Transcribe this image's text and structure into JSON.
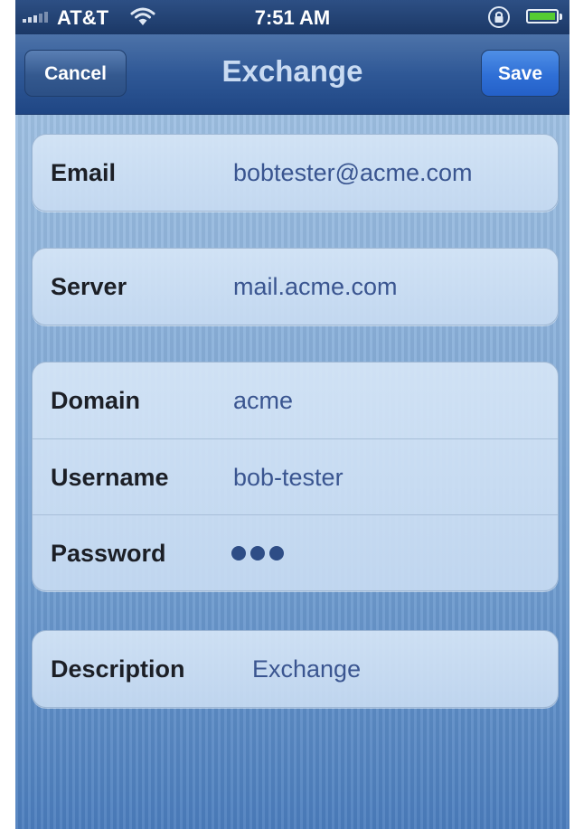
{
  "status_bar": {
    "carrier": "AT&T",
    "time": "7:51 AM",
    "icons": [
      "signal-icon",
      "wifi-icon",
      "rotation-lock-icon",
      "battery-icon"
    ],
    "battery_level": 1.0
  },
  "nav_bar": {
    "title": "Exchange",
    "cancel_label": "Cancel",
    "save_label": "Save"
  },
  "account": {
    "email": {
      "label": "Email",
      "value": "bobtester@acme.com"
    },
    "server": {
      "label": "Server",
      "value": "mail.acme.com"
    },
    "domain": {
      "label": "Domain",
      "value": "acme"
    },
    "username": {
      "label": "Username",
      "value": "bob-tester"
    },
    "password": {
      "label": "Password",
      "masked_length": 3
    },
    "description": {
      "label": "Description",
      "value": "Exchange"
    }
  },
  "colors": {
    "nav_bar": "#2f5896",
    "save_button": "#2f6fd6",
    "value_text": "#3a5590",
    "background": "#8fb4dc"
  }
}
